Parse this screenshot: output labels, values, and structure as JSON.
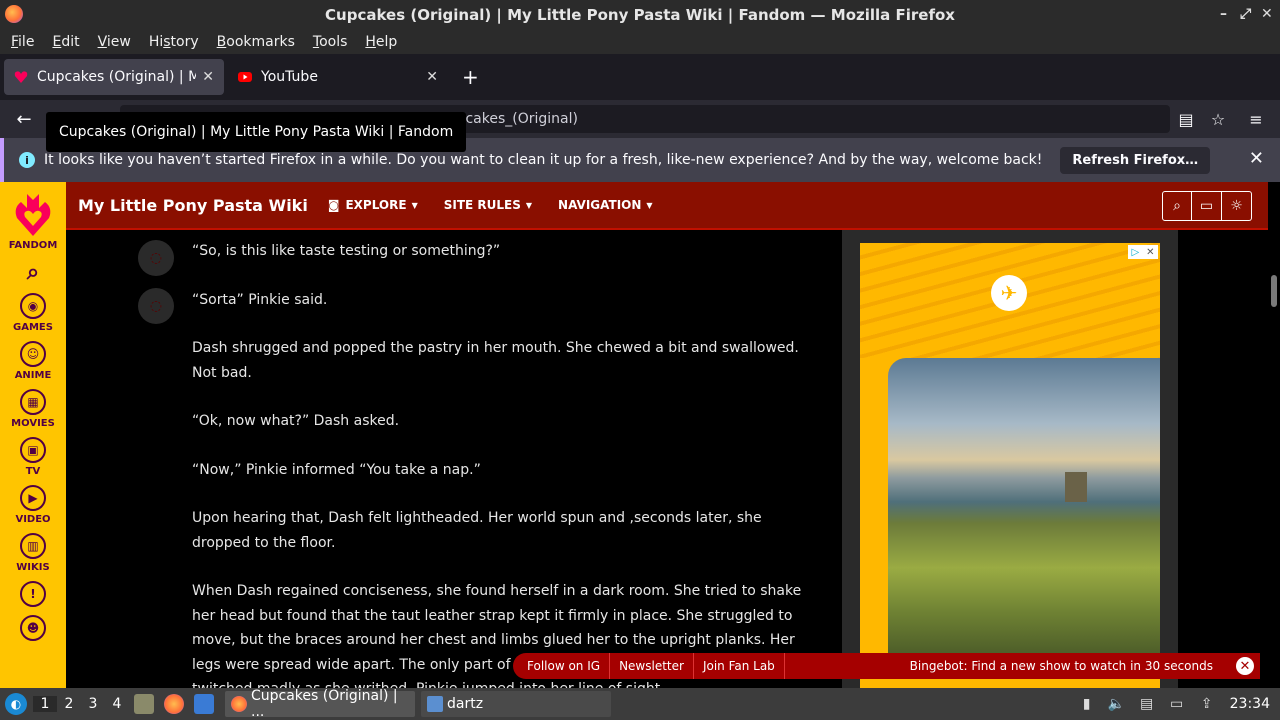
{
  "window": {
    "title": "Cupcakes (Original) | My Little Pony Pasta Wiki | Fandom — Mozilla Firefox",
    "minimize": "–",
    "maximize": "⤢",
    "close": "✕"
  },
  "menu": [
    "File",
    "Edit",
    "View",
    "History",
    "Bookmarks",
    "Tools",
    "Help"
  ],
  "menu_access_keys": [
    "F",
    "E",
    "V",
    "s",
    "B",
    "T",
    "H"
  ],
  "tabs": [
    {
      "label": "Cupcakes (Original) | My Little Pony Pasta Wiki | Fandom",
      "close": "✕"
    },
    {
      "label": "YouTube",
      "close": "✕"
    }
  ],
  "new_tab": "+",
  "nav": {
    "back": "←",
    "url_visible": "cupcakes_(Original)",
    "reader": "▤",
    "bookmark": "☆",
    "menu": "≡"
  },
  "tooltip": "Cupcakes (Original) | My Little Pony Pasta Wiki | Fandom",
  "notification": {
    "icon": "i",
    "text": "It looks like you haven’t started Firefox in a while. Do you want to clean it up for a fresh, like-new experience? And by the way, welcome back!",
    "button": "Refresh Firefox…",
    "close": "✕"
  },
  "rail": {
    "logo_label": "FANDOM",
    "items": [
      {
        "label": "",
        "icon": "search-icon"
      },
      {
        "label": "GAMES",
        "icon": "gamepad-icon"
      },
      {
        "label": "ANIME",
        "icon": "anime-icon"
      },
      {
        "label": "MOVIES",
        "icon": "clapper-icon"
      },
      {
        "label": "TV",
        "icon": "tv-icon"
      },
      {
        "label": "VIDEO",
        "icon": "play-icon"
      },
      {
        "label": "WIKIS",
        "icon": "book-icon"
      },
      {
        "label": "",
        "icon": "alert-icon"
      },
      {
        "label": "",
        "icon": "user-icon"
      }
    ]
  },
  "wiki": {
    "name": "My Little Pony Pasta Wiki",
    "nav": [
      "EXPLORE",
      "SITE RULES",
      "NAVIGATION"
    ],
    "caret": "▼"
  },
  "article": {
    "paragraphs": [
      "“So, is this like taste testing or something?”",
      "“Sorta” Pinkie said.",
      "Dash shrugged and popped the pastry in her mouth. She chewed a bit and swallowed. Not bad.",
      "“Ok, now what?” Dash asked.",
      "“Now,” Pinkie informed “You take a nap.”",
      "Upon hearing that, Dash felt lightheaded. Her world spun and ,seconds later, she dropped to the floor.",
      "When Dash regained conciseness, she found herself in a dark room. She tried to shake her head but found that the taut leather strap kept it firmly in place. She struggled to move, but the braces around her chest and limbs glued her to the upright planks. Her legs were spread wide apart. The only part of her not tied down were her wings which twitched madly as she writhed. Pinkie jumped into her line of sight."
    ]
  },
  "sticky": {
    "links": [
      "Follow on IG",
      "Newsletter",
      "Join Fan Lab"
    ],
    "bingebot": "Bingebot: Find a new show to watch in 30 seconds",
    "close": "✕"
  },
  "taskbar": {
    "workspaces": [
      "1",
      "2",
      "3",
      "4"
    ],
    "tasks": [
      {
        "label": "Cupcakes (Original) | ..."
      },
      {
        "label": "dartz"
      }
    ],
    "clock": "23:34"
  }
}
